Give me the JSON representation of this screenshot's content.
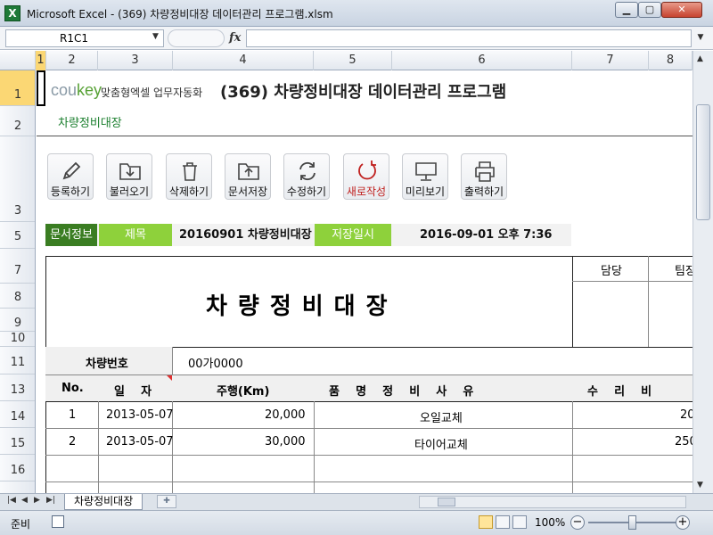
{
  "window": {
    "title": "Microsoft Excel - (369) 차량정비대장 데이터관리 프로그램.xlsm",
    "app_icon": "excel-icon",
    "controls": [
      "minimize-icon",
      "maximize-icon",
      "close-icon"
    ]
  },
  "formula_bar": {
    "name_box": "R1C1",
    "fx_label": "fx",
    "formula": ""
  },
  "columns": [
    "1",
    "2",
    "3",
    "4",
    "5",
    "6",
    "7",
    "8"
  ],
  "rows": [
    "1",
    "2",
    "3",
    "5",
    "7",
    "8",
    "9",
    "10",
    "11",
    "13",
    "14",
    "15",
    "16"
  ],
  "header": {
    "logo_prefix": "cou",
    "logo_key": "key",
    "logo_slogan": "맞춤형엑셀 업무자동화",
    "program_title": "(369) 차량정비대장 데이터관리 프로그램",
    "sheet_subtitle": "차량정비대장"
  },
  "toolbar": [
    {
      "label": "등록하기",
      "icon": "pencil-icon"
    },
    {
      "label": "불러오기",
      "icon": "folder-download-icon"
    },
    {
      "label": "삭제하기",
      "icon": "trash-icon"
    },
    {
      "label": "문서저장",
      "icon": "folder-upload-icon"
    },
    {
      "label": "수정하기",
      "icon": "refresh-icon"
    },
    {
      "label": "새로작성",
      "icon": "new-circle-icon",
      "color": "#c0201e"
    },
    {
      "label": "미리보기",
      "icon": "monitor-icon"
    },
    {
      "label": "출력하기",
      "icon": "printer-icon"
    }
  ],
  "doc_info": {
    "label": "문서정보",
    "title_label": "제목",
    "title_value": "20160901 차량정비대장",
    "saved_label": "저장일시",
    "saved_value": "2016-09-01  오후 7:36",
    "dark_green": "#3a7d22",
    "light_green": "#8ed13b"
  },
  "form": {
    "title": "차량정비대장",
    "approval_1": "담당",
    "approval_2": "팀장",
    "vehicle_label": "차량번호",
    "vehicle_value": "00가0000",
    "table_headers": [
      "No.",
      "일    자",
      "주행(Km)",
      "품    명    정    비    사    유",
      "수    리    비"
    ],
    "rows": [
      {
        "no": "1",
        "date": "2013-05-07",
        "km": "20,000",
        "reason": "오일교체",
        "cost": "20"
      },
      {
        "no": "2",
        "date": "2013-05-07",
        "km": "30,000",
        "reason": "타이어교체",
        "cost": "250"
      }
    ]
  },
  "sheet_tabs": {
    "active": "차량정비대장"
  },
  "status": {
    "ready": "준비",
    "zoom": "100%",
    "zoom_out": "−",
    "zoom_in": "+",
    "zoom_fraction": 0.5
  }
}
